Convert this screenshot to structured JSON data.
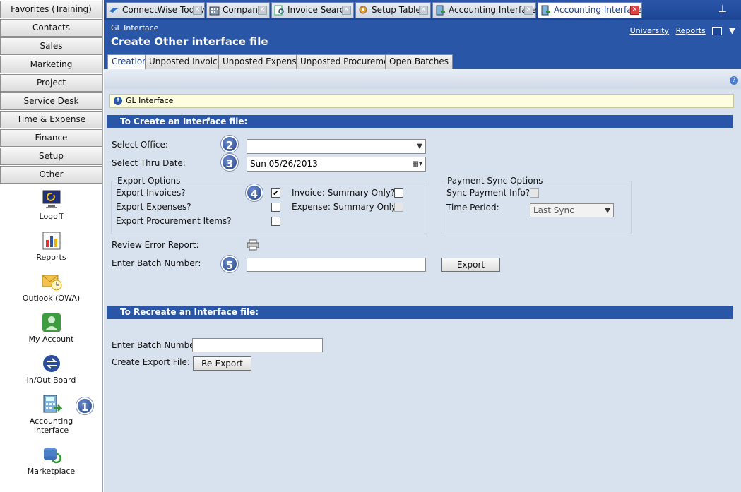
{
  "sidebar": {
    "nav": [
      "Favorites (Training)",
      "Contacts",
      "Sales",
      "Marketing",
      "Project",
      "Service Desk",
      "Time & Expense",
      "Finance",
      "Setup",
      "Other"
    ],
    "icons": [
      {
        "label": "Logoff",
        "icon": "logoff-icon"
      },
      {
        "label": "Reports",
        "icon": "reports-icon"
      },
      {
        "label": "Outlook (OWA)",
        "icon": "outlook-icon"
      },
      {
        "label": "My Account",
        "icon": "my-account-icon"
      },
      {
        "label": "In/Out Board",
        "icon": "inout-board-icon"
      },
      {
        "label": "Accounting Interface",
        "icon": "accounting-interface-icon"
      },
      {
        "label": "Marketplace",
        "icon": "marketplace-icon"
      }
    ]
  },
  "tabs": [
    {
      "label": "ConnectWise Today"
    },
    {
      "label": "Company"
    },
    {
      "label": "Invoice Search"
    },
    {
      "label": "Setup Tables"
    },
    {
      "label": "Accounting Interface"
    },
    {
      "label": "Accounting Interface",
      "active": true
    }
  ],
  "header": {
    "breadcrumb": "GL Interface",
    "title": "Create Other interface file",
    "links": [
      "University",
      "Reports"
    ]
  },
  "subtabs": [
    "Creation",
    "Unposted Invoices",
    "Unposted Expenses",
    "Unposted Procurement",
    "Open Batches"
  ],
  "info": {
    "text": "GL Interface"
  },
  "create": {
    "section_title": "To Create an Interface file:",
    "select_office_label": "Select Office:",
    "select_office_value": "",
    "thru_date_label": "Select Thru Date:",
    "thru_date_value": "Sun  05/26/2013",
    "export_options_title": "Export Options",
    "export_invoices_label": "Export Invoices?",
    "export_expenses_label": "Export Expenses?",
    "export_procurement_label": "Export Procurement Items?",
    "invoice_summary_label": "Invoice: Summary Only?",
    "expense_summary_label": "Expense: Summary Only?",
    "payment_sync_title": "Payment Sync Options",
    "sync_payment_label": "Sync Payment Info?",
    "time_period_label": "Time Period:",
    "time_period_value": "Last Sync",
    "review_error_label": "Review Error Report:",
    "batch_number_label": "Enter Batch Number:",
    "export_button": "Export",
    "export_invoices_checked": true
  },
  "recreate": {
    "section_title": "To Recreate an Interface file:",
    "batch_number_label": "Enter Batch Number:",
    "create_export_label": "Create Export File:",
    "reexport_button": "Re-Export"
  },
  "markers": [
    "1",
    "2",
    "3",
    "4",
    "5"
  ],
  "colors": {
    "header_blue": "#2a56a8",
    "panel_bg": "#d8e2ee",
    "info_bg": "#fffddf"
  }
}
